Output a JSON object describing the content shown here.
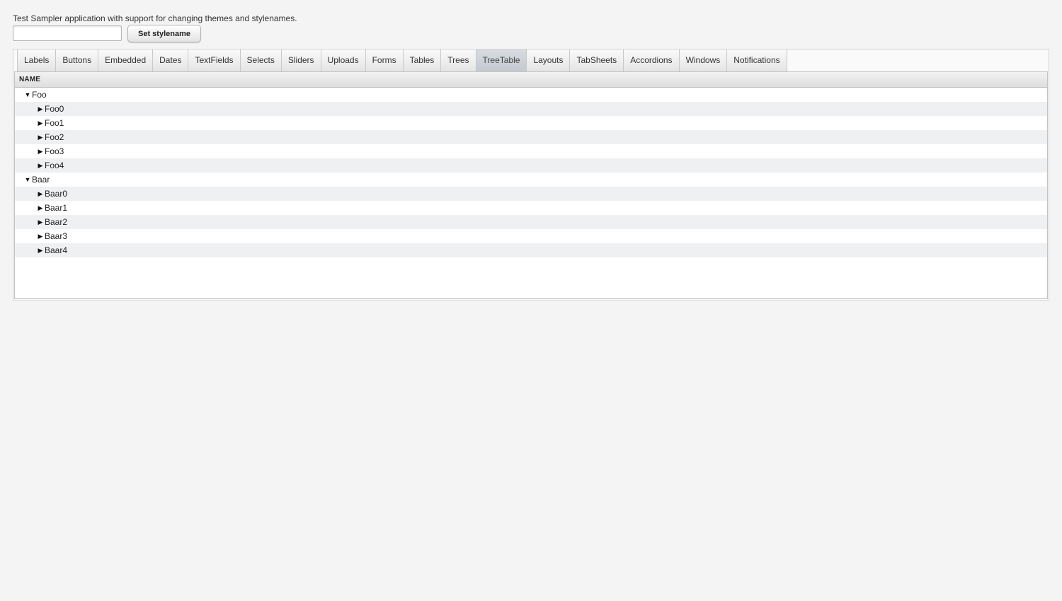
{
  "intro_text": "Test Sampler application with support for changing themes and stylenames.",
  "stylename": {
    "input_value": "",
    "button_label": "Set stylename"
  },
  "tabs": [
    {
      "label": "Labels"
    },
    {
      "label": "Buttons"
    },
    {
      "label": "Embedded"
    },
    {
      "label": "Dates"
    },
    {
      "label": "TextFields"
    },
    {
      "label": "Selects"
    },
    {
      "label": "Sliders"
    },
    {
      "label": "Uploads"
    },
    {
      "label": "Forms"
    },
    {
      "label": "Tables"
    },
    {
      "label": "Trees"
    },
    {
      "label": "TreeTable"
    },
    {
      "label": "Layouts"
    },
    {
      "label": "TabSheets"
    },
    {
      "label": "Accordions"
    },
    {
      "label": "Windows"
    },
    {
      "label": "Notifications"
    }
  ],
  "selected_tab": "TreeTable",
  "treetable": {
    "column_header": "NAME",
    "rows": [
      {
        "label": "Foo",
        "level": 0,
        "expanded": true
      },
      {
        "label": "Foo0",
        "level": 1,
        "expanded": false
      },
      {
        "label": "Foo1",
        "level": 1,
        "expanded": false
      },
      {
        "label": "Foo2",
        "level": 1,
        "expanded": false
      },
      {
        "label": "Foo3",
        "level": 1,
        "expanded": false
      },
      {
        "label": "Foo4",
        "level": 1,
        "expanded": false
      },
      {
        "label": "Baar",
        "level": 0,
        "expanded": true
      },
      {
        "label": "Baar0",
        "level": 1,
        "expanded": false
      },
      {
        "label": "Baar1",
        "level": 1,
        "expanded": false
      },
      {
        "label": "Baar2",
        "level": 1,
        "expanded": false
      },
      {
        "label": "Baar3",
        "level": 1,
        "expanded": false
      },
      {
        "label": "Baar4",
        "level": 1,
        "expanded": false
      }
    ]
  }
}
